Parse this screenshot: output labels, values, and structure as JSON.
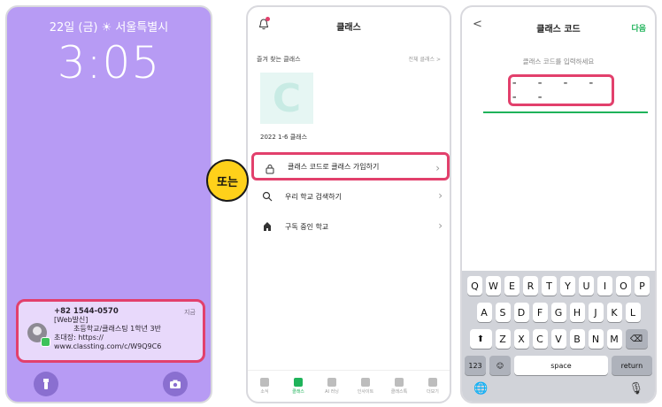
{
  "lock": {
    "date": "22일 (금) ☀ 서울특별시",
    "time": "3:05",
    "notification": {
      "sender": "+82 1544-0570",
      "time": "지금",
      "lines": [
        "[Web발신]",
        "초등학교/클래스팅 1학년 3반",
        "초대장: https://",
        "www.classting.com/c/W9Q9C6"
      ]
    }
  },
  "badge": {
    "label": "또는"
  },
  "app": {
    "title": "클래스",
    "favorites": "즐겨 찾는 클래스",
    "all_classes": "전체 클래스 >",
    "class_card": {
      "letter": "C",
      "name": "2022 1-6 클래스"
    },
    "rows": [
      {
        "label": "클래스 코드로 클래스 가입하기",
        "icon": "lock-icon"
      },
      {
        "label": "우리 학교 검색하기",
        "icon": "search-icon"
      },
      {
        "label": "구독 중인 학교",
        "icon": "school-icon"
      }
    ],
    "tabs": [
      {
        "label": "소식"
      },
      {
        "label": "클래스"
      },
      {
        "label": "AI 러닝"
      },
      {
        "label": "인사이트"
      },
      {
        "label": "클래스톡"
      },
      {
        "label": "더보기"
      }
    ]
  },
  "code": {
    "title": "클래스 코드",
    "next": "다음",
    "back": "<",
    "prompt": "클래스 코드를 입력하세요",
    "placeholder": "- - - - - -",
    "keyboard": {
      "row1": [
        "Q",
        "W",
        "E",
        "R",
        "T",
        "Y",
        "U",
        "I",
        "O",
        "P"
      ],
      "row2": [
        "A",
        "S",
        "D",
        "F",
        "G",
        "H",
        "J",
        "K",
        "L"
      ],
      "row3": [
        "Z",
        "X",
        "C",
        "V",
        "B",
        "N",
        "M"
      ],
      "num": "123",
      "space": "space",
      "return": "return"
    }
  },
  "colors": {
    "accent": "#1fb35a",
    "highlight": "#e2406c",
    "lock_bg": "#b79bf4"
  }
}
